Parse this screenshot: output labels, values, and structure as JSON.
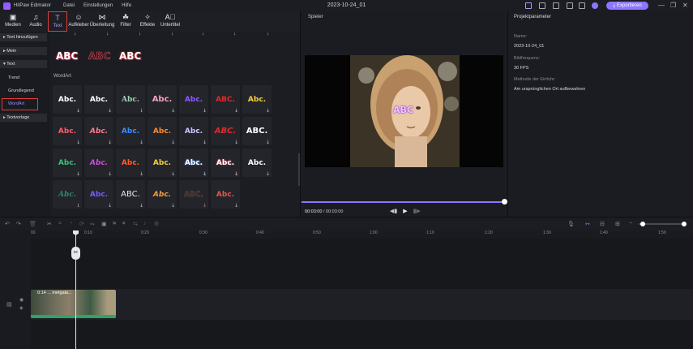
{
  "titlebar": {
    "app_name": "HitPaw Edimakor",
    "menu": [
      "Datei",
      "Einstellungen",
      "Hilfe"
    ],
    "document_title": "2023-10-24_01",
    "export_label": "Exportieren",
    "accent_color": "#8d76ff"
  },
  "toolbar": {
    "tools": [
      {
        "label": "Medien",
        "icon": "media-icon"
      },
      {
        "label": "Audio",
        "icon": "music-icon"
      },
      {
        "label": "Text",
        "icon": "text-icon"
      },
      {
        "label": "Aufkleber",
        "icon": "sticker-icon"
      },
      {
        "label": "Überleitung",
        "icon": "transition-icon"
      },
      {
        "label": "Filter",
        "icon": "filter-icon"
      },
      {
        "label": "Effekte",
        "icon": "effects-icon"
      },
      {
        "label": "Untertitel",
        "icon": "subtitle-icon"
      }
    ],
    "selected": "Text"
  },
  "leftnav": {
    "text_hinzufuegen": "Text hinzufügen",
    "mein": "Mein",
    "text": "Text",
    "trend": "Trend",
    "grundlegend": "Grundlegend",
    "wordart": "WordArt",
    "textvorlage": "Textvorlage"
  },
  "content": {
    "section_label": "WordArt",
    "top_samples": [
      "ABC",
      "ABC",
      "ABC"
    ],
    "tiles_row1": [
      "Abc.",
      "Abc.",
      "Abc.",
      "Abc.",
      "Abc.",
      "ABC.",
      "Abc."
    ],
    "tiles_row2": [
      "Abc.",
      "Abc.",
      "Abc.",
      "Abc.",
      "Abc.",
      "ABC.",
      "ABC."
    ],
    "tiles_row3": [
      "Abc.",
      "Abc.",
      "Abc.",
      "Abc.",
      "Abc.",
      "Abc.",
      "Abc."
    ],
    "tiles_row4": [
      "Abc.",
      "Abc.",
      "ABC.",
      "Abc.",
      "ABC.",
      "Abc."
    ]
  },
  "player": {
    "title": "Spieler",
    "overlay_text": "ABC",
    "time_current": "00:03:00",
    "time_total": "00:03:00"
  },
  "props": {
    "title": "Projektparameter",
    "name_label": "Name:",
    "name_value": "2023-10-24_01",
    "fps_label": "Bildfrequenz:",
    "fps_value": "30 FPS",
    "import_label": "Methode der Einfuhr:",
    "import_value": "Am ursprünglichen Ort aufbewahren"
  },
  "timeline": {
    "ruler": [
      "00",
      "0:10",
      "0:20",
      "0:30",
      "0:40",
      "0:50",
      "1:00",
      "1:10",
      "1:20",
      "1:30",
      "1:40",
      "1:50"
    ],
    "clip_label": "0:14 ... metgala..."
  }
}
